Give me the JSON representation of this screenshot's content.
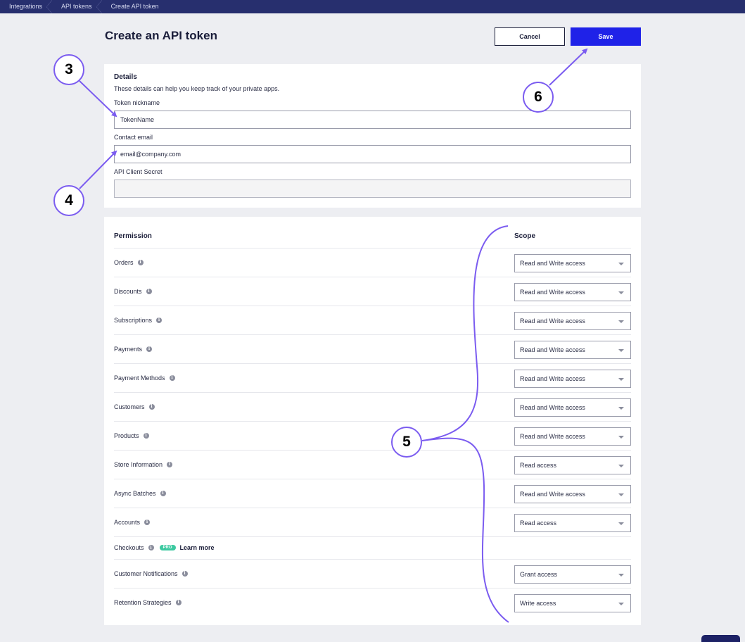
{
  "breadcrumb": [
    "Integrations",
    "API tokens",
    "Create API token"
  ],
  "page_title": "Create an API token",
  "actions": {
    "cancel": "Cancel",
    "save": "Save"
  },
  "details": {
    "title": "Details",
    "description": "These details can help you keep track of your private apps.",
    "nickname_label": "Token nickname",
    "nickname_value": "TokenName",
    "email_label": "Contact email",
    "email_value": "email@company.com",
    "secret_label": "API Client Secret",
    "secret_value": ""
  },
  "permissions": {
    "permission_header": "Permission",
    "scope_header": "Scope",
    "rows": [
      {
        "name": "Orders",
        "scope": "Read and Write access"
      },
      {
        "name": "Discounts",
        "scope": "Read and Write access"
      },
      {
        "name": "Subscriptions",
        "scope": "Read and Write access"
      },
      {
        "name": "Payments",
        "scope": "Read and Write access"
      },
      {
        "name": "Payment Methods",
        "scope": "Read and Write access"
      },
      {
        "name": "Customers",
        "scope": "Read and Write access"
      },
      {
        "name": "Products",
        "scope": "Read and Write access"
      },
      {
        "name": "Store Information",
        "scope": "Read access"
      },
      {
        "name": "Async Batches",
        "scope": "Read and Write access"
      },
      {
        "name": "Accounts",
        "scope": "Read access"
      }
    ],
    "checkouts": {
      "name": "Checkouts",
      "badge": "PRO",
      "link": "Learn more"
    },
    "rows_after": [
      {
        "name": "Customer Notifications",
        "scope": "Grant access"
      },
      {
        "name": "Retention Strategies",
        "scope": "Write access"
      }
    ]
  },
  "annotations": {
    "a3": "3",
    "a4": "4",
    "a5": "5",
    "a6": "6",
    "color": "#7b5cf0"
  },
  "icons": {
    "info": "info-icon",
    "dropdown": "chevron-down-icon"
  }
}
